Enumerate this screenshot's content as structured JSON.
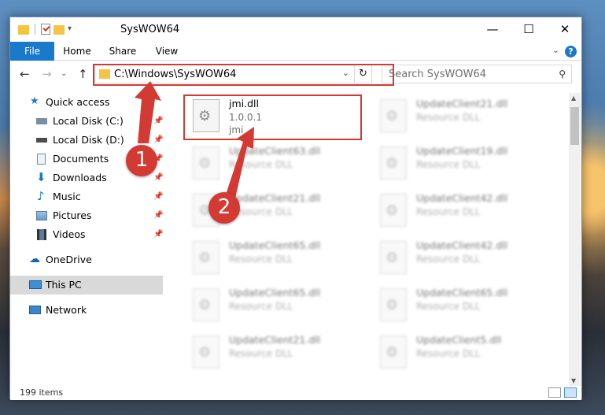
{
  "window": {
    "title": "SysWOW64",
    "controls": {
      "minimize": "—",
      "maximize": "☐",
      "close": "✕"
    }
  },
  "ribbon": {
    "tabs": [
      "File",
      "Home",
      "Share",
      "View"
    ],
    "help": "?"
  },
  "navigation": {
    "address": "C:\\Windows\\SysWOW64",
    "search_placeholder": "Search SysWOW64"
  },
  "sidebar": {
    "items": [
      {
        "label": "Quick access",
        "icon": "star-icon",
        "pinned": false
      },
      {
        "label": "Local Disk (C:)",
        "icon": "drive-icon",
        "pinned": true
      },
      {
        "label": "Local Disk (D:)",
        "icon": "drive-icon",
        "pinned": true
      },
      {
        "label": "Documents",
        "icon": "documents-icon",
        "pinned": true
      },
      {
        "label": "Downloads",
        "icon": "download-icon",
        "pinned": true
      },
      {
        "label": "Music",
        "icon": "music-icon",
        "pinned": true
      },
      {
        "label": "Pictures",
        "icon": "pictures-icon",
        "pinned": true
      },
      {
        "label": "Videos",
        "icon": "videos-icon",
        "pinned": true
      },
      {
        "label": "OneDrive",
        "icon": "cloud-icon",
        "pinned": false
      },
      {
        "label": "This PC",
        "icon": "computer-icon",
        "pinned": false,
        "selected": true
      },
      {
        "label": "Network",
        "icon": "network-icon",
        "pinned": false
      }
    ]
  },
  "files": {
    "highlighted": {
      "name": "jmi.dll",
      "version": "1.0.0.1",
      "description": "jmi"
    },
    "others": [
      {
        "name": "UpdateClient21.dll",
        "type": "Resource DLL"
      },
      {
        "name": "UpdateClient63.dll",
        "type": "Resource DLL"
      },
      {
        "name": "UpdateClient19.dll",
        "type": "Resource DLL"
      },
      {
        "name": "UpdateClient21.dll",
        "type": "Resource DLL"
      },
      {
        "name": "UpdateClient42.dll",
        "type": "Resource DLL"
      },
      {
        "name": "UpdateClient65.dll",
        "type": "Resource DLL"
      },
      {
        "name": "UpdateClient42.dll",
        "type": "Resource DLL"
      },
      {
        "name": "UpdateClient65.dll",
        "type": "Resource DLL"
      },
      {
        "name": "UpdateClient65.dll",
        "type": "Resource DLL"
      },
      {
        "name": "UpdateClient21.dll",
        "type": "Resource DLL"
      },
      {
        "name": "UpdateClient5.dll",
        "type": "Resource DLL"
      }
    ]
  },
  "annotations": {
    "step1": "1",
    "step2": "2"
  },
  "status": {
    "item_count": "199 items"
  },
  "colors": {
    "accent": "#1979ca",
    "highlight": "#d33a34"
  }
}
